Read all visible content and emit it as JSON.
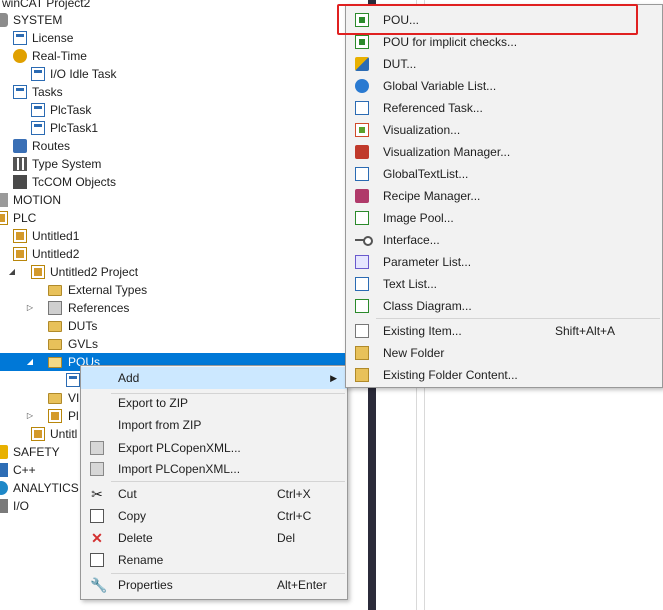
{
  "tree": {
    "rows": [
      {
        "label": "winCAT Project2",
        "icon": "solution-icon"
      },
      {
        "label": "SYSTEM",
        "icon": "gear-icon"
      },
      {
        "label": "License",
        "icon": "license-icon"
      },
      {
        "label": "Real-Time",
        "icon": "realtime-icon"
      },
      {
        "label": "I/O Idle Task",
        "icon": "task-icon"
      },
      {
        "label": "Tasks",
        "icon": "tasks-icon"
      },
      {
        "label": "PlcTask",
        "icon": "task-icon"
      },
      {
        "label": "PlcTask1",
        "icon": "task-icon"
      },
      {
        "label": "Routes",
        "icon": "routes-icon"
      },
      {
        "label": "Type System",
        "icon": "type-system-icon"
      },
      {
        "label": "TcCOM Objects",
        "icon": "tccom-icon"
      },
      {
        "label": "MOTION",
        "icon": "motion-icon"
      },
      {
        "label": "PLC",
        "icon": "plc-icon"
      },
      {
        "label": "Untitled1",
        "icon": "plc-project-icon"
      },
      {
        "label": "Untitled2",
        "icon": "plc-project-icon"
      },
      {
        "label": "Untitled2 Project",
        "icon": "plc-project-icon"
      },
      {
        "label": "External Types",
        "icon": "folder-icon"
      },
      {
        "label": "References",
        "icon": "references-icon"
      },
      {
        "label": "DUTs",
        "icon": "folder-icon"
      },
      {
        "label": "GVLs",
        "icon": "folder-icon"
      },
      {
        "label": "POUs",
        "icon": "folder-open-icon"
      },
      {
        "label": "",
        "icon": "pou-file-icon"
      },
      {
        "label": "VIS",
        "icon": "folder-icon"
      },
      {
        "label": "Pl",
        "icon": "plc-icon"
      },
      {
        "label": "Untitl",
        "icon": "plc-project-icon"
      },
      {
        "label": "SAFETY",
        "icon": "safety-icon"
      },
      {
        "label": "C++",
        "icon": "cpp-icon"
      },
      {
        "label": "ANALYTICS",
        "icon": "analytics-icon"
      },
      {
        "label": "I/O",
        "icon": "io-icon"
      }
    ]
  },
  "context_menu": {
    "items": [
      {
        "label": "Add",
        "icon": "",
        "shortcut": "",
        "submenu": true
      },
      {
        "label": "Export to ZIP",
        "icon": "",
        "shortcut": ""
      },
      {
        "label": "Import from ZIP",
        "icon": "",
        "shortcut": ""
      },
      {
        "label": "Export PLCopenXML...",
        "icon": "plcopen-export-icon",
        "shortcut": ""
      },
      {
        "label": "Import PLCopenXML...",
        "icon": "plcopen-import-icon",
        "shortcut": ""
      },
      {
        "label": "Cut",
        "icon": "cut-icon",
        "shortcut": "Ctrl+X"
      },
      {
        "label": "Copy",
        "icon": "copy-icon",
        "shortcut": "Ctrl+C"
      },
      {
        "label": "Delete",
        "icon": "delete-icon",
        "shortcut": "Del"
      },
      {
        "label": "Rename",
        "icon": "rename-icon",
        "shortcut": ""
      },
      {
        "label": "Properties",
        "icon": "wrench-icon",
        "shortcut": "Alt+Enter"
      }
    ]
  },
  "add_menu": {
    "items": [
      {
        "label": "POU...",
        "icon": "pou-icon",
        "shortcut": ""
      },
      {
        "label": "POU for implicit checks...",
        "icon": "pou-checks-icon",
        "shortcut": ""
      },
      {
        "label": "DUT...",
        "icon": "dut-icon",
        "shortcut": ""
      },
      {
        "label": "Global Variable List...",
        "icon": "globe-icon",
        "shortcut": ""
      },
      {
        "label": "Referenced Task...",
        "icon": "referenced-task-icon",
        "shortcut": ""
      },
      {
        "label": "Visualization...",
        "icon": "visualization-icon",
        "shortcut": ""
      },
      {
        "label": "Visualization Manager...",
        "icon": "visualization-manager-icon",
        "shortcut": ""
      },
      {
        "label": "GlobalTextList...",
        "icon": "global-text-list-icon",
        "shortcut": ""
      },
      {
        "label": "Recipe Manager...",
        "icon": "recipe-manager-icon",
        "shortcut": ""
      },
      {
        "label": "Image Pool...",
        "icon": "image-pool-icon",
        "shortcut": ""
      },
      {
        "label": "Interface...",
        "icon": "interface-icon",
        "shortcut": ""
      },
      {
        "label": "Parameter List...",
        "icon": "parameter-list-icon",
        "shortcut": ""
      },
      {
        "label": "Text List...",
        "icon": "text-list-icon",
        "shortcut": ""
      },
      {
        "label": "Class Diagram...",
        "icon": "class-diagram-icon",
        "shortcut": ""
      },
      {
        "label": "Existing Item...",
        "icon": "existing-item-icon",
        "shortcut": "Shift+Alt+A"
      },
      {
        "label": "New Folder",
        "icon": "new-folder-icon",
        "shortcut": ""
      },
      {
        "label": "Existing Folder Content...",
        "icon": "folder-content-icon",
        "shortcut": ""
      }
    ]
  },
  "colors": {
    "selection": "#0078d7",
    "menu_background": "#f2f2f2",
    "highlight_box": "#e02020"
  }
}
